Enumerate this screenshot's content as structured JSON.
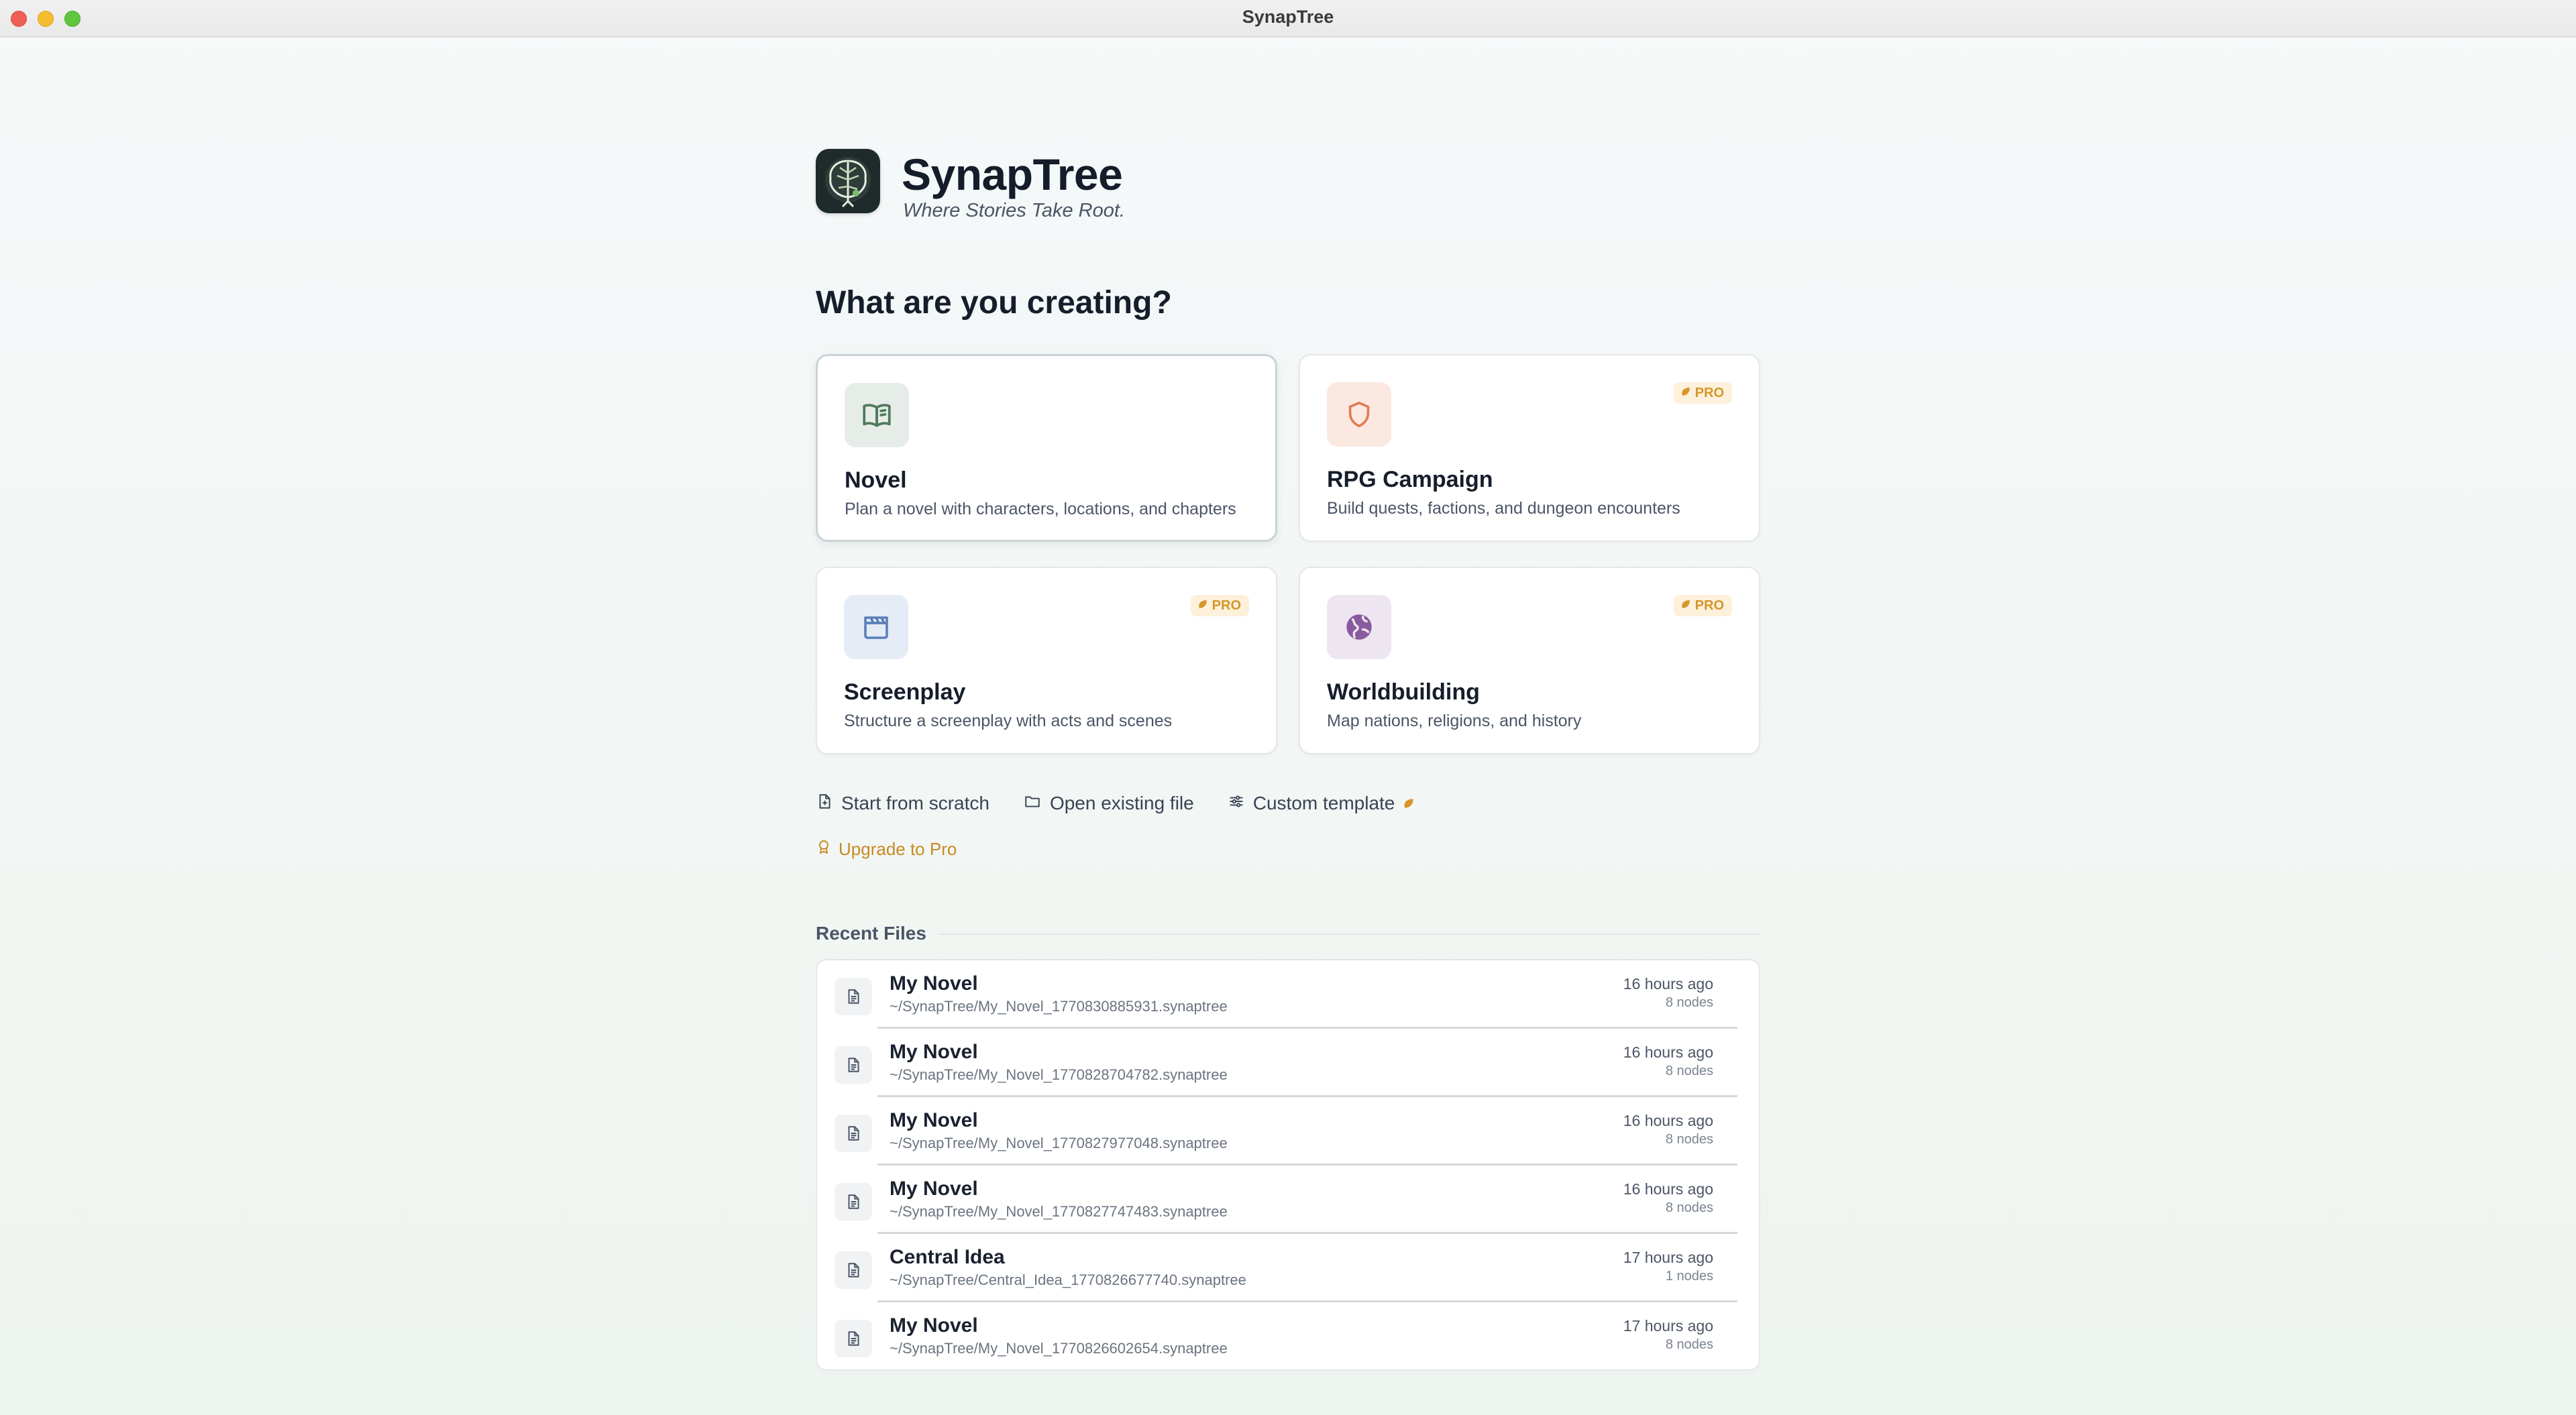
{
  "window": {
    "title": "SynapTree"
  },
  "brand": {
    "name": "SynapTree",
    "tagline": "Where Stories Take Root."
  },
  "section_title": "What are you creating?",
  "cards": [
    {
      "title": "Novel",
      "description": "Plan a novel with characters, locations, and chapters",
      "icon": "open-book-icon",
      "pro": false
    },
    {
      "title": "RPG Campaign",
      "description": "Build quests, factions, and dungeon encounters",
      "icon": "shield-icon",
      "pro": true
    },
    {
      "title": "Screenplay",
      "description": "Structure a screenplay with acts and scenes",
      "icon": "clapperboard-icon",
      "pro": true
    },
    {
      "title": "Worldbuilding",
      "description": "Map nations, religions, and history",
      "icon": "globe-icon",
      "pro": true
    }
  ],
  "pro_label": "PRO",
  "actions": {
    "start_scratch": "Start from scratch",
    "open_existing": "Open existing file",
    "custom_template": "Custom template"
  },
  "upgrade_label": "Upgrade to Pro",
  "recent": {
    "title": "Recent Files",
    "files": [
      {
        "name": "My Novel",
        "path": "~/SynapTree/My_Novel_1770830885931.synaptree",
        "time": "16 hours ago",
        "nodes": "8 nodes"
      },
      {
        "name": "My Novel",
        "path": "~/SynapTree/My_Novel_1770828704782.synaptree",
        "time": "16 hours ago",
        "nodes": "8 nodes"
      },
      {
        "name": "My Novel",
        "path": "~/SynapTree/My_Novel_1770827977048.synaptree",
        "time": "16 hours ago",
        "nodes": "8 nodes"
      },
      {
        "name": "My Novel",
        "path": "~/SynapTree/My_Novel_1770827747483.synaptree",
        "time": "16 hours ago",
        "nodes": "8 nodes"
      },
      {
        "name": "Central Idea",
        "path": "~/SynapTree/Central_Idea_1770826677740.synaptree",
        "time": "17 hours ago",
        "nodes": "1 nodes"
      },
      {
        "name": "My Novel",
        "path": "~/SynapTree/My_Novel_1770826602654.synaptree",
        "time": "17 hours ago",
        "nodes": "8 nodes"
      }
    ]
  },
  "colors": {
    "accent_green": "#4f7a5c",
    "pro_gold": "#d6962a",
    "shield_orange": "#e07a55",
    "screen_blue": "#5b7fb8",
    "globe_purple": "#8a5a9e"
  }
}
